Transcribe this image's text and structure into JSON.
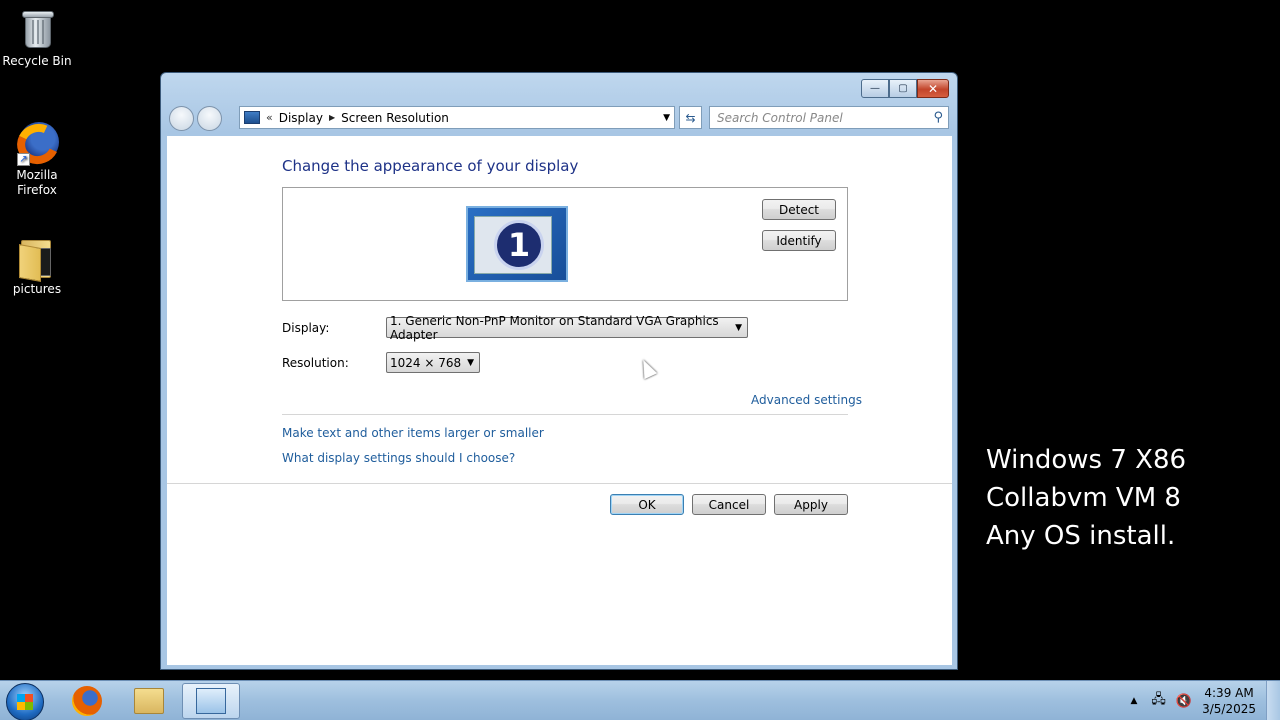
{
  "desktop": {
    "icons": [
      {
        "label": "Recycle Bin"
      },
      {
        "label": "Mozilla Firefox"
      },
      {
        "label": "pictures"
      }
    ],
    "overlay_lines": [
      "Windows 7 X86",
      "Collabvm VM 8",
      "Any OS install."
    ]
  },
  "window": {
    "caption": {
      "minimize": "—",
      "maximize": "▢",
      "close": "✕"
    },
    "address": {
      "chevron": "«",
      "crumbs": [
        "Display",
        "Screen Resolution"
      ]
    },
    "search": {
      "placeholder": "Search Control Panel"
    },
    "heading": "Change the appearance of your display",
    "monitor_number": "1",
    "detect_label": "Detect",
    "identify_label": "Identify",
    "display_label": "Display:",
    "display_value": "1. Generic Non-PnP Monitor on Standard VGA Graphics Adapter",
    "resolution_label": "Resolution:",
    "resolution_value": "1024 × 768",
    "advanced_link": "Advanced settings",
    "link_larger_text": "Make text and other items larger or smaller",
    "link_which_settings": "What display settings should I choose?",
    "ok_label": "OK",
    "cancel_label": "Cancel",
    "apply_label": "Apply"
  },
  "taskbar": {
    "clock_time": "4:39 AM",
    "clock_date": "3/5/2025"
  },
  "icons": {
    "start": "windows-start-orb",
    "search": "magnifier-icon",
    "refresh": "refresh-icon"
  }
}
